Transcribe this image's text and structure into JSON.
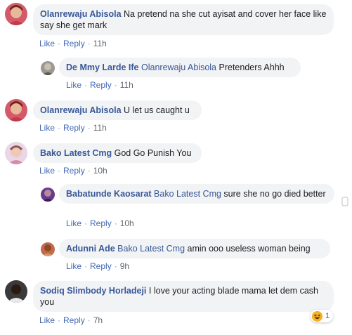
{
  "actions": {
    "like": "Like",
    "reply": "Reply",
    "sep": "·"
  },
  "comments": [
    {
      "author": "Olanrewaju Abisola",
      "mention": "",
      "text": "Na pretend na she cut ayisat and cover her face like say she get mark",
      "time": "11h"
    },
    {
      "author": "De Mmy Larde Ife",
      "mention": "Olanrewaju Abisola",
      "text": "Pretenders Ahhh",
      "time": "11h"
    },
    {
      "author": "Olanrewaju Abisola",
      "mention": "",
      "text": "U let us caught u",
      "time": "11h"
    },
    {
      "author": "Bako Latest Cmg",
      "mention": "",
      "text": "God Go Punish You",
      "time": "10h"
    },
    {
      "author": "Babatunde Kaosarat",
      "mention": "Bako Latest Cmg",
      "text": "sure she no go died better",
      "time": "10h"
    },
    {
      "author": "Adunni Ade",
      "mention": "Bako Latest Cmg",
      "text": "amin ooo useless woman being",
      "time": "9h"
    },
    {
      "author": "Sodiq Slimbody Horladeji",
      "mention": "",
      "text": "I love your acting blade mama let dem cash you",
      "time": "7h"
    }
  ],
  "reaction": {
    "icon": "haha-emoji-icon",
    "count": "1"
  },
  "colors": {
    "link": "#385898",
    "bubble": "#f2f3f5",
    "meta": "#606770"
  }
}
